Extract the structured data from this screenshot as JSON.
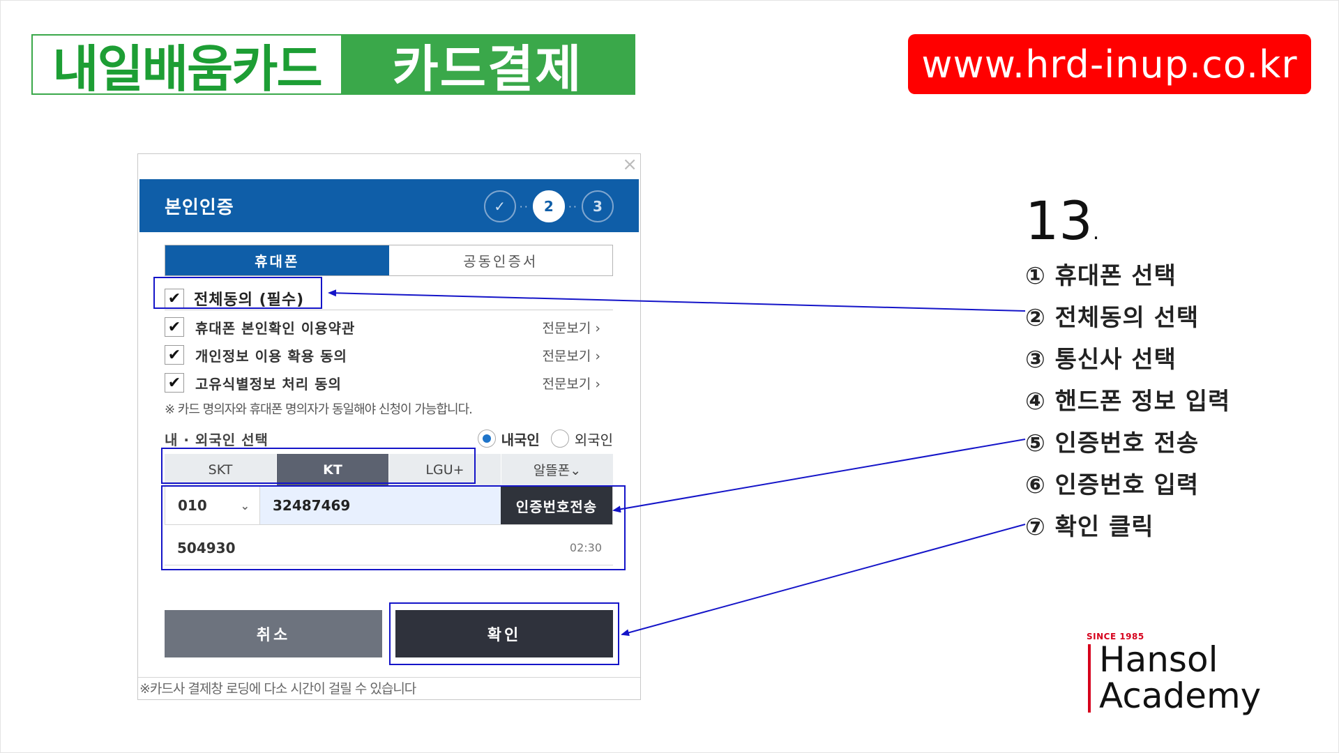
{
  "banner": {
    "title_left": "내일배움카드",
    "title_right": "카드결제",
    "url": "www.hrd-inup.co.kr",
    "colors": {
      "green": "#3aa84a",
      "red": "#ff0000"
    }
  },
  "dialog": {
    "close_glyph": "×",
    "title": "본인인증",
    "steps": [
      "✓",
      "2",
      "3"
    ],
    "step_dots": "··",
    "tabs": [
      {
        "label": "휴대폰",
        "active": true
      },
      {
        "label": "공동인증서",
        "active": false
      }
    ],
    "agree_all": {
      "label": "전체동의 (필수)",
      "checked": true
    },
    "check_glyph": "✔",
    "terms": [
      {
        "label": "휴대폰 본인확인 이용약관",
        "view": "전문보기 ›"
      },
      {
        "label": "개인정보 이용 확용 동의",
        "view": "전문보기 ›"
      },
      {
        "label": "고유식별정보 처리 동의",
        "view": "전문보기 ›"
      }
    ],
    "notice": "※ 카드 명의자와 휴대폰 명의자가 동일해야 신청이 가능합니다.",
    "nationality": {
      "label": "내 · 외국인 선택",
      "options": [
        "내국인",
        "외국인"
      ],
      "selected": "내국인"
    },
    "carriers": [
      {
        "label": "SKT",
        "active": false
      },
      {
        "label": "KT",
        "active": true
      },
      {
        "label": "LGU+",
        "active": false
      },
      {
        "label": "알뜰폰⌄",
        "active": false
      }
    ],
    "phone": {
      "prefix": "010",
      "prefix_chevron": "⌄",
      "number": "32487469",
      "send_label": "인증번호전송"
    },
    "code": {
      "value": "504930",
      "timer": "02:30"
    },
    "cancel_label": "취소",
    "ok_label": "확인",
    "footer_note": "※카드사 결제창 로딩에 다소 시간이 걸릴 수 있습니다"
  },
  "guide": {
    "step_number": "13",
    "step_dot": ".",
    "items": [
      "① 휴대폰 선택",
      "② 전체동의 선택",
      "③ 통신사 선택",
      "④ 핸드폰 정보 입력",
      "⑤ 인증번호 전송",
      "⑥ 인증번호 입력",
      "⑦ 확인 클릭"
    ],
    "arrow_color": "#1414c8"
  },
  "logo": {
    "since": "SINCE 1985",
    "line1": "Hansol",
    "line2": "Academy",
    "accent": "#d6001c"
  }
}
